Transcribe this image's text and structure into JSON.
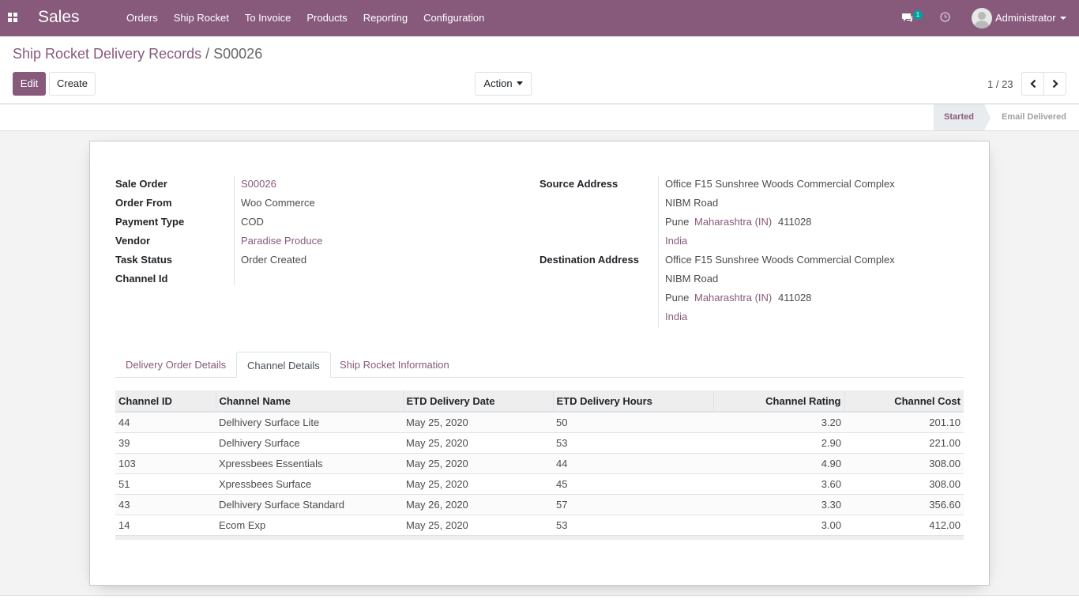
{
  "navbar": {
    "app_name": "Sales",
    "menu": [
      "Orders",
      "Ship Rocket",
      "To Invoice",
      "Products",
      "Reporting",
      "Configuration"
    ],
    "chat_count": "1",
    "user_name": "Administrator",
    "color": "#875a7b"
  },
  "breadcrumb": {
    "parent": "Ship Rocket Delivery Records",
    "separator": "/",
    "current": "S00026"
  },
  "buttons": {
    "edit": "Edit",
    "create": "Create",
    "action": "Action"
  },
  "pager": {
    "value": "1 / 23"
  },
  "statusbar": {
    "stages": [
      "Started",
      "Email Delivered"
    ],
    "active": "Started"
  },
  "form": {
    "left": {
      "sale_order_label": "Sale Order",
      "sale_order": "S00026",
      "order_from_label": "Order From",
      "order_from": "Woo Commerce",
      "payment_type_label": "Payment Type",
      "payment_type": "COD",
      "vendor_label": "Vendor",
      "vendor": "Paradise Produce",
      "task_status_label": "Task Status",
      "task_status": "Order Created",
      "channel_id_label": "Channel Id",
      "channel_id": ""
    },
    "source": {
      "label": "Source Address",
      "street": "Office F15 Sunshree Woods Commercial Complex",
      "street2": "NIBM Road",
      "city": "Pune",
      "state": "Maharashtra (IN)",
      "zip": "411028",
      "country": "India"
    },
    "destination": {
      "label": "Destination Address",
      "street": "Office F15 Sunshree Woods Commercial Complex",
      "street2": "NIBM Road",
      "city": "Pune",
      "state": "Maharashtra (IN)",
      "zip": "411028",
      "country": "India"
    }
  },
  "tabs": [
    {
      "label": "Delivery Order Details"
    },
    {
      "label": "Channel Details"
    },
    {
      "label": "Ship Rocket Information"
    }
  ],
  "active_tab": "Channel Details",
  "channels": {
    "columns": [
      "Channel ID",
      "Channel Name",
      "ETD Delivery Date",
      "ETD Delivery Hours",
      "Channel Rating",
      "Channel Cost"
    ],
    "rows": [
      [
        "44",
        "Delhivery Surface Lite",
        "May 25, 2020",
        "50",
        "3.20",
        "201.10"
      ],
      [
        "39",
        "Delhivery Surface",
        "May 25, 2020",
        "53",
        "2.90",
        "221.00"
      ],
      [
        "103",
        "Xpressbees Essentials",
        "May 25, 2020",
        "44",
        "4.90",
        "308.00"
      ],
      [
        "51",
        "Xpressbees Surface",
        "May 25, 2020",
        "45",
        "3.60",
        "308.00"
      ],
      [
        "43",
        "Delhivery Surface Standard",
        "May 26, 2020",
        "57",
        "3.30",
        "356.60"
      ],
      [
        "14",
        "Ecom Exp",
        "May 25, 2020",
        "53",
        "3.00",
        "412.00"
      ]
    ]
  }
}
